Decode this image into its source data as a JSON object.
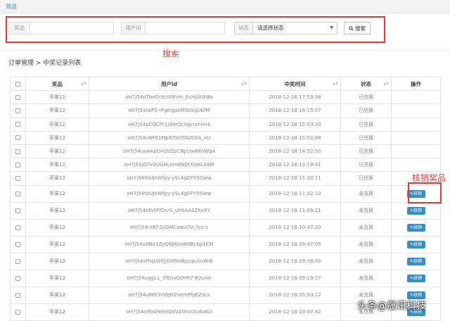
{
  "topbar": {
    "title": "筛选"
  },
  "filter": {
    "prize_label": "奖品",
    "prize_value": "",
    "user_label": "用户id",
    "user_value": "",
    "status_label": "状态",
    "status_value": "请选择状态",
    "search_label": "搜索",
    "search_icon": "search-icon"
  },
  "annotations": {
    "search": "搜索",
    "verify": "核销奖品"
  },
  "breadcrumb": "订单管理 > 中奖记录列表",
  "table": {
    "headers": [
      "",
      "奖品",
      "用户id",
      "中奖时间",
      "状态",
      "操作"
    ],
    "action_label": "核销",
    "rows": [
      {
        "prize": "苹果12",
        "user": "oH7j54pTbeOr8cW8Vm_EcHJUUh8o",
        "time": "2018-12-18 17:53:38",
        "status": "已兑换",
        "action": false
      },
      {
        "prize": "苹果12",
        "user": "oH7j54lwP5-rFgmgsbM9sXgUKfM",
        "time": "2018-12-18 16:15:57",
        "status": "已兑换",
        "action": false
      },
      {
        "prize": "苹果12",
        "user": "oH7j54pCQCPr1j49rQcVaJnaYxH4",
        "time": "2018-12-18 15:59:30",
        "status": "已兑换",
        "action": false
      },
      {
        "prize": "苹果12",
        "user": "oH7j54uNF61MpR7bOTA0tlXA_xU",
        "time": "2018-12-18 15:52:08",
        "status": "已兑换",
        "action": false
      },
      {
        "prize": "苹果12",
        "user": "oH7j54uvwkpDH2bZpCNpUw88nWq4",
        "time": "2018-12-18 14:52:50",
        "status": "已兑换",
        "action": false
      },
      {
        "prize": "苹果12",
        "user": "oH7j54jO7v3UGHLem8NDfXGHLS6M",
        "time": "2018-12-18 13:19:41",
        "status": "已兑换",
        "action": false
      },
      {
        "prize": "苹果12",
        "user": "oH7j54tbUJnWfpy-ySL4gDFY5Gww",
        "time": "2018-12-18 11:32:11",
        "status": "已兑换",
        "action": false
      },
      {
        "prize": "苹果12",
        "user": "oH7j54tbUJnWfpy-ySL4gDFY5Gww",
        "time": "2018-12-18 11:32:10",
        "status": "未兑换",
        "action": true
      },
      {
        "prize": "苹果12",
        "user": "oH7j54s3VtFfDsrS_uhSAA2ZKxXY",
        "time": "2018-12-18 11:06:21",
        "status": "未兑换",
        "action": true
      },
      {
        "prize": "苹果12",
        "user": "oH7j54rXKf-2JIGMCwea7U_fcu-s",
        "time": "2018-12-18 10:47:29",
        "status": "未兑换",
        "action": true
      },
      {
        "prize": "苹果12",
        "user": "oH7j54u0Na1ZyQ6bEoo80Bcbp1KM",
        "time": "2018-12-18 09:47:05",
        "status": "未兑换",
        "action": true
      },
      {
        "prize": "苹果12",
        "user": "oH7j54vfFqLWQjXWMd8pcquXuWdl",
        "time": "2018-12-18 09:38:00",
        "status": "未兑换",
        "action": true
      },
      {
        "prize": "苹果12",
        "user": "oH7j54uggL1_7fEnyG0HR7-B2u4A",
        "time": "2018-12-18 09:19:57",
        "status": "未兑换",
        "action": true
      },
      {
        "prize": "苹果12",
        "user": "oH7j54uRPCIVlDJRZVemPfyEZScs",
        "time": "2018-12-18 05:50:12",
        "status": "未兑换",
        "action": true
      },
      {
        "prize": "苹果12",
        "user": "oH7j54o90AFe83QdVZGrxcbu6aKU",
        "time": "2018-12-18 03:47:42",
        "status": "未兑换",
        "action": true
      }
    ]
  },
  "watermark": "头条@晟讯科技",
  "colors": {
    "accent": "#3c8dbc",
    "annotation": "#e23a3a"
  }
}
